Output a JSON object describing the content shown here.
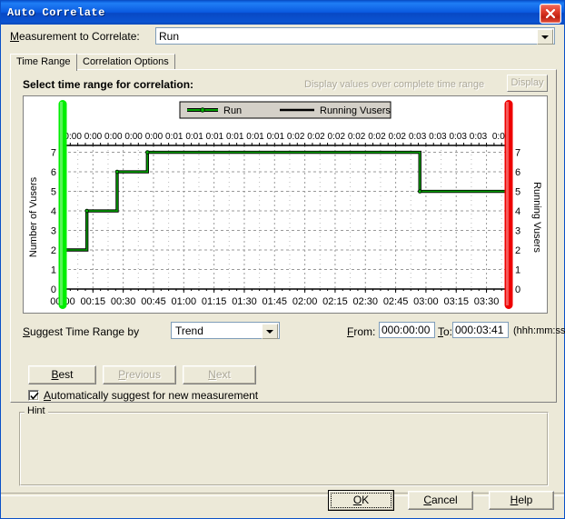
{
  "window": {
    "title": "Auto Correlate",
    "close_icon": "close-x-icon"
  },
  "measurement": {
    "label": "Measurement to Correlate:",
    "value": "Run",
    "dropdown_icon": "chevron-down-icon"
  },
  "tabs": [
    {
      "label": "Time Range",
      "active": true
    },
    {
      "label": "Correlation Options",
      "active": false
    }
  ],
  "panel": {
    "select_label": "Select time range for correlation:",
    "display_hint": "Display values over complete time range",
    "display_button": "Display"
  },
  "suggest": {
    "label": "Suggest Time Range by",
    "value": "Trend",
    "dropdown_icon": "chevron-down-icon",
    "from_label": "From:",
    "from_value": "000:00:00",
    "to_label": "To:",
    "to_value": "000:03:41",
    "format_label": "(hhh:mm:ss)"
  },
  "nav_buttons": {
    "best": "Best",
    "previous": "Previous",
    "next": "Next"
  },
  "auto_suggest": {
    "label": "Automatically suggest for new measurement",
    "checked": true,
    "check_icon": "checkmark-icon"
  },
  "hint": {
    "legend": "Hint",
    "text": ""
  },
  "dialog_buttons": {
    "ok": "OK",
    "cancel": "Cancel",
    "help": "Help"
  },
  "colors": {
    "title_bar": "#0a5ae0",
    "dialog_face": "#ECE9D8",
    "series_run": "#00A000",
    "series_vusers": "#000000",
    "handle_start": "#00EE00",
    "handle_end": "#EE0000",
    "disabled_text": "#ACA899"
  },
  "chart_data": {
    "type": "line",
    "title": "",
    "xlabel": "",
    "ylabel": "Number of Vusers",
    "y2label": "Running Vusers",
    "grid": true,
    "legend_position": "top-center",
    "xlim": [
      0,
      221
    ],
    "ylim": [
      0,
      7.35
    ],
    "yticks": [
      0,
      1,
      2,
      3,
      4,
      5,
      6,
      7
    ],
    "y2ticks": [
      0,
      1,
      2,
      3,
      4,
      5,
      6,
      7
    ],
    "xtick_labels": [
      "00:00",
      "00:15",
      "00:30",
      "00:45",
      "01:00",
      "01:15",
      "01:30",
      "01:45",
      "02:00",
      "02:15",
      "02:30",
      "02:45",
      "03:00",
      "03:15",
      "03:30"
    ],
    "xtick_values": [
      0,
      15,
      30,
      45,
      60,
      75,
      90,
      105,
      120,
      135,
      150,
      165,
      180,
      195,
      210
    ],
    "top_axis_labels": [
      "0:00",
      "0:00",
      "0:00",
      "0:00",
      "0:00",
      "0:01",
      "0:01",
      "0:01",
      "0:01",
      "0:01",
      "0:01",
      "0:02",
      "0:02",
      "0:02",
      "0:02",
      "0:02",
      "0:02",
      "0:03",
      "0:03",
      "0:03",
      "0:03",
      "0:0"
    ],
    "series": [
      {
        "name": "Run",
        "color": "#00A000",
        "style": "step",
        "x": [
          0,
          0,
          12,
          12,
          27,
          27,
          42,
          42,
          177,
          177,
          221
        ],
        "values": [
          0,
          2,
          2,
          4,
          4,
          6,
          6,
          7,
          7,
          5,
          5
        ]
      },
      {
        "name": "Running Vusers",
        "color": "#000000",
        "style": "step",
        "x": [
          0,
          0,
          12,
          12,
          27,
          27,
          42,
          42,
          177,
          177,
          221
        ],
        "values": [
          0,
          2,
          2,
          4,
          4,
          6,
          6,
          7,
          7,
          5,
          5
        ]
      }
    ],
    "range_handles": {
      "start": {
        "label": "00:00",
        "value": 0,
        "color": "#00EE00"
      },
      "end": {
        "label": "03:41",
        "value": 221,
        "color": "#EE0000"
      }
    }
  }
}
